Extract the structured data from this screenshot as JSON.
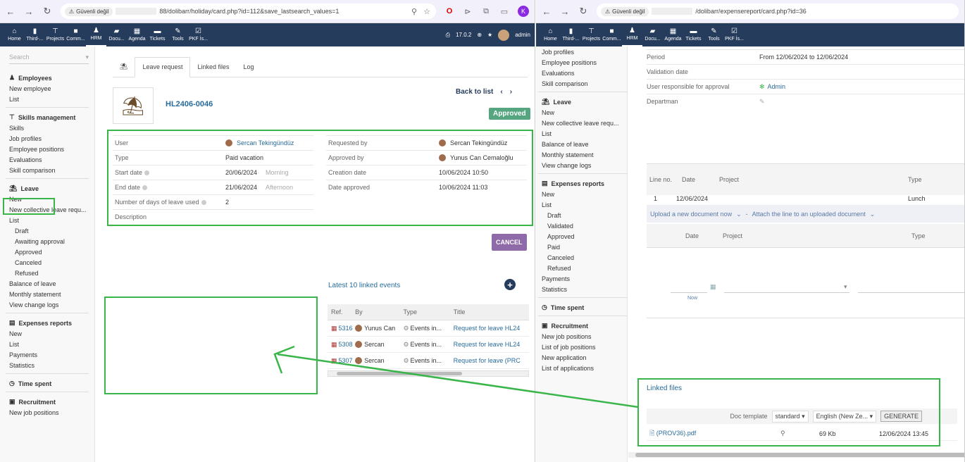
{
  "browser_left": {
    "security_label": "Güvenli değil",
    "url": "88/dolibarr/holiday/card.php?id=112&save_lastsearch_values=1",
    "profile_initial": "K"
  },
  "browser_right": {
    "security_label": "Güvenli değil",
    "url": "/dolibarr/expensereport/card.php?id=36"
  },
  "topmenu": [
    "Home",
    "Third-...",
    "Projects",
    "Comm...",
    "HRM",
    "Docu...",
    "Agenda",
    "Tickets",
    "Tools",
    "PKF İs..."
  ],
  "topmenu_right": [
    "Home",
    "Third-...",
    "Projects",
    "Comm...",
    "HRM",
    "Docu...",
    "Agenda",
    "Tickets",
    "Tools",
    "PKF İs..."
  ],
  "topbar_right": {
    "version": "17.0.2",
    "user": "admin"
  },
  "sidebar": {
    "search_placeholder": "Search",
    "sections": [
      {
        "title": "Employees",
        "items": [
          {
            "label": "New employee"
          },
          {
            "label": "List"
          }
        ]
      },
      {
        "title": "Skills management",
        "items": [
          {
            "label": "Skills"
          },
          {
            "label": "Job profiles"
          },
          {
            "label": "Employee positions"
          },
          {
            "label": "Evaluations"
          },
          {
            "label": "Skill comparison"
          }
        ]
      },
      {
        "title": "Leave",
        "items": [
          {
            "label": "New"
          },
          {
            "label": "New collective leave requ..."
          },
          {
            "label": "List"
          },
          {
            "label": "Draft",
            "sub": true
          },
          {
            "label": "Awaiting approval",
            "sub": true
          },
          {
            "label": "Approved",
            "sub": true
          },
          {
            "label": "Canceled",
            "sub": true
          },
          {
            "label": "Refused",
            "sub": true
          },
          {
            "label": "Balance of leave"
          },
          {
            "label": "Monthly statement"
          },
          {
            "label": "View change logs"
          }
        ]
      },
      {
        "title": "Expenses reports",
        "items": [
          {
            "label": "New"
          },
          {
            "label": "List"
          },
          {
            "label": "Payments"
          },
          {
            "label": "Statistics"
          }
        ]
      },
      {
        "title": "Time spent",
        "items": []
      },
      {
        "title": "Recruitment",
        "items": [
          {
            "label": "New job positions"
          }
        ]
      }
    ]
  },
  "tabs": [
    "Leave request",
    "Linked files",
    "Log"
  ],
  "record": {
    "ref": "HL2406-0046",
    "status": "Approved",
    "back_to_list": "Back to list",
    "cancel_button": "CANCEL"
  },
  "fields_left": [
    {
      "label": "User",
      "value": "Sercan Tekingündüz",
      "extra": ""
    },
    {
      "label": "Type",
      "value": "Paid vacation",
      "extra": ""
    },
    {
      "label": "Start date",
      "value": "20/06/2024",
      "extra": "Morning"
    },
    {
      "label": "End date",
      "value": "21/06/2024",
      "extra": "Afternoon"
    },
    {
      "label": "Number of days of leave used",
      "value": "2",
      "extra": ""
    },
    {
      "label": "Description",
      "value": "",
      "extra": ""
    }
  ],
  "fields_right": [
    {
      "label": "Requested by",
      "value": "Sercan Tekingündüz"
    },
    {
      "label": "Approved by",
      "value": "Yunus Can Cemaloğlu"
    },
    {
      "label": "Creation date",
      "value": "10/06/2024 10:50"
    },
    {
      "label": "Date approved",
      "value": "10/06/2024 11:03"
    }
  ],
  "events": {
    "title": "Latest 10 linked events",
    "columns": [
      "Ref.",
      "By",
      "Type",
      "Title"
    ],
    "rows": [
      {
        "ref": "5316",
        "by": "Yunus Can",
        "type": "Events in...",
        "title": "Request for leave HL24"
      },
      {
        "ref": "5308",
        "by": "Sercan",
        "type": "Events in...",
        "title": "Request for leave HL24"
      },
      {
        "ref": "5307",
        "by": "Sercan",
        "type": "Events in...",
        "title": "Request for leave (PRC"
      }
    ]
  },
  "right_sidebar": {
    "pre_items": [
      "Job profiles",
      "Employee positions",
      "Evaluations",
      "Skill comparison"
    ],
    "sections": [
      {
        "title": "Leave",
        "items": [
          {
            "label": "New"
          },
          {
            "label": "New collective leave requ..."
          },
          {
            "label": "List"
          },
          {
            "label": "Balance of leave"
          },
          {
            "label": "Monthly statement"
          },
          {
            "label": "View change logs"
          }
        ]
      },
      {
        "title": "Expenses reports",
        "items": [
          {
            "label": "New"
          },
          {
            "label": "List"
          },
          {
            "label": "Draft",
            "sub": true
          },
          {
            "label": "Validated",
            "sub": true
          },
          {
            "label": "Approved",
            "sub": true
          },
          {
            "label": "Paid",
            "sub": true
          },
          {
            "label": "Canceled",
            "sub": true
          },
          {
            "label": "Refused",
            "sub": true
          },
          {
            "label": "Payments"
          },
          {
            "label": "Statistics"
          }
        ]
      },
      {
        "title": "Time spent",
        "items": []
      },
      {
        "title": "Recruitment",
        "items": [
          {
            "label": "New job positions"
          },
          {
            "label": "List of job positions"
          },
          {
            "label": "New application"
          },
          {
            "label": "List of applications"
          }
        ]
      }
    ]
  },
  "expense": {
    "fields": [
      {
        "label": "Period",
        "value": "From 12/06/2024 to 12/06/2024"
      },
      {
        "label": "Validation date",
        "value": ""
      },
      {
        "label": "User responsible for approval",
        "value": "Admin"
      },
      {
        "label": "Departman",
        "value": ""
      }
    ],
    "lines_columns": [
      "Line no.",
      "Date",
      "Project",
      "Type"
    ],
    "line": {
      "no": "1",
      "date": "12/06/2024",
      "type": "Lunch"
    },
    "upload_label": "Upload a new document now",
    "attach_label": "Attach the line to an uploaded document",
    "newline_columns": [
      "Date",
      "Project",
      "Type"
    ],
    "now_label": "Now",
    "linked_files_title": "Linked files",
    "doc_template_label": "Doc template",
    "doc_template_value": "standard",
    "lang_value": "English (New Ze...",
    "generate_label": "GENERATE",
    "file": {
      "name": "(PROV36).pdf",
      "size": "69 Kb",
      "date": "12/06/2024 13:45"
    }
  }
}
